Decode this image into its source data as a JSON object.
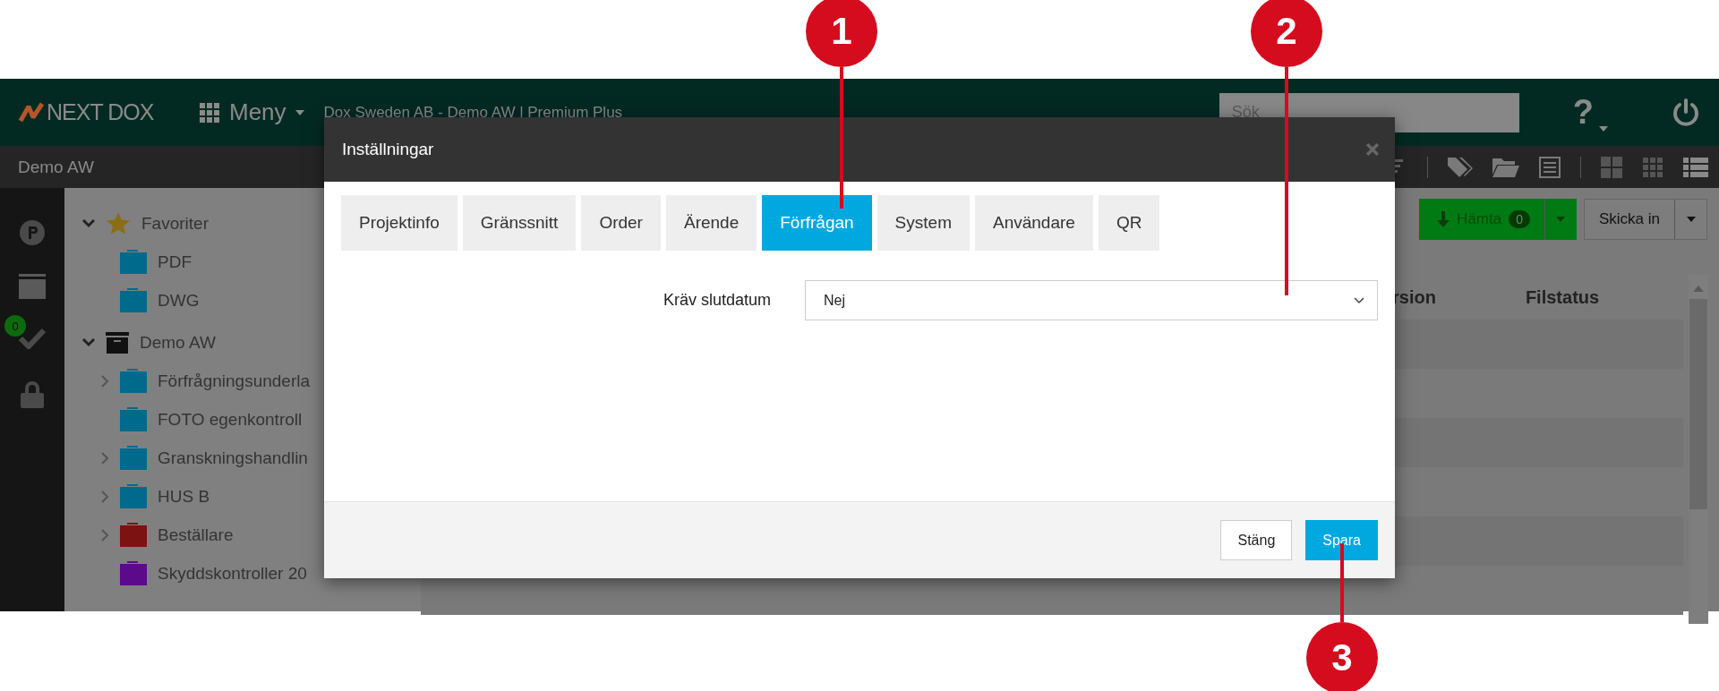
{
  "callouts": [
    {
      "number": "1"
    },
    {
      "number": "2"
    },
    {
      "number": "3"
    }
  ],
  "top_bar": {
    "logo": "NEXT DOX",
    "menu": "Meny",
    "project_title": "Dox Sweden AB - Demo AW | Premium Plus",
    "search": {
      "placeholder": "Sök"
    },
    "help": "?"
  },
  "sub_bar": {
    "title": "Demo AW"
  },
  "side_rail": {
    "badge": "0"
  },
  "tree": [
    {
      "label": "Favoriter",
      "kind": "favorites",
      "expanded": true,
      "children": [
        {
          "label": "PDF",
          "color": "#006a8c",
          "expandable": false
        },
        {
          "label": "DWG",
          "color": "#006a8c",
          "expandable": false
        }
      ]
    },
    {
      "label": "Demo AW",
      "kind": "archive",
      "expanded": true,
      "children": [
        {
          "label": "Förfrågningsunderla",
          "color": "#006a8c",
          "expandable": true
        },
        {
          "label": "FOTO egenkontroll",
          "color": "#006a8c",
          "expandable": false
        },
        {
          "label": "Granskningshandlin",
          "color": "#006a8c",
          "expandable": true
        },
        {
          "label": "HUS B",
          "color": "#006a8c",
          "expandable": true
        },
        {
          "label": "Beställare",
          "color": "#7c1212",
          "expandable": true
        },
        {
          "label": "Skyddskontroller 20",
          "color": "#5b0a8c",
          "expandable": false
        }
      ]
    }
  ],
  "actions": {
    "download": {
      "label": "Hämta",
      "count": "0"
    },
    "submit": {
      "label": "Skicka in"
    }
  },
  "table": {
    "columns": [
      {
        "label": "rsion"
      },
      {
        "label": "Filstatus"
      }
    ]
  },
  "dialog": {
    "title": "Inställningar",
    "tabs": [
      {
        "label": "Projektinfo",
        "selected": false
      },
      {
        "label": "Gränssnitt",
        "selected": false
      },
      {
        "label": "Order",
        "selected": false
      },
      {
        "label": "Ärende",
        "selected": false
      },
      {
        "label": "Förfrågan",
        "selected": true
      },
      {
        "label": "System",
        "selected": false
      },
      {
        "label": "Användare",
        "selected": false
      },
      {
        "label": "QR",
        "selected": false
      }
    ],
    "fields": [
      {
        "label": "Kräv slutdatum",
        "value": "Nej"
      }
    ],
    "buttons": [
      {
        "label": "Stäng",
        "kind": "secondary"
      },
      {
        "label": "Spara",
        "kind": "primary"
      }
    ]
  }
}
